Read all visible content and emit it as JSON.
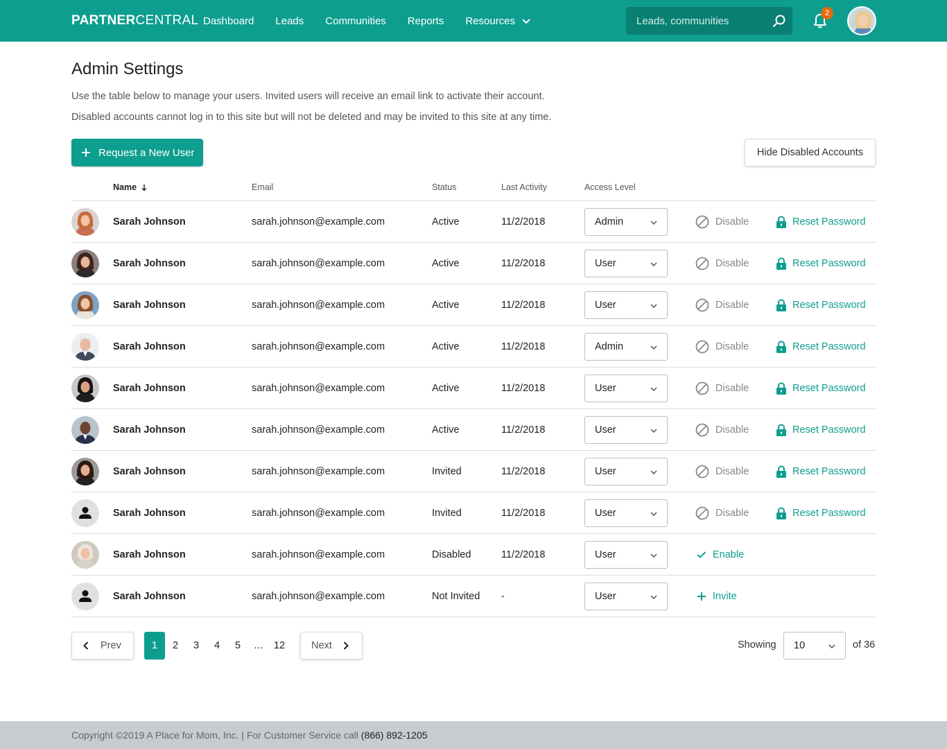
{
  "header": {
    "brand_bold": "PARTNER",
    "brand_light": "CENTRAL",
    "nav": [
      {
        "label": "Dashboard"
      },
      {
        "label": "Leads"
      },
      {
        "label": "Communities"
      },
      {
        "label": "Reports"
      },
      {
        "label": "Resources"
      }
    ],
    "search_placeholder": "Leads, communities",
    "notification_count": "2",
    "brand_color": "#0e9e8f"
  },
  "page": {
    "title": "Admin Settings",
    "description_1": "Use the table below to manage your users. Invited users will receive an email link to activate their account.",
    "description_2": "Disabled accounts cannot log in to this site but will not be deleted and may be invited to this site at any time.",
    "request_button": "Request a New User",
    "hide_disabled_button": "Hide Disabled Accounts"
  },
  "table": {
    "columns": {
      "name": "Name",
      "email": "Email",
      "status": "Status",
      "last_activity": "Last Activity",
      "access_level": "Access Level"
    },
    "rows": [
      {
        "name": "Sarah Johnson",
        "email": "sarah.johnson@example.com",
        "status": "Active",
        "last_activity": "11/2/2018",
        "access": "Admin",
        "action": "Disable",
        "secondary_action": "Reset Password",
        "avatar": "photo-1"
      },
      {
        "name": "Sarah Johnson",
        "email": "sarah.johnson@example.com",
        "status": "Active",
        "last_activity": "11/2/2018",
        "access": "User",
        "action": "Disable",
        "secondary_action": "Reset Password",
        "avatar": "photo-2"
      },
      {
        "name": "Sarah Johnson",
        "email": "sarah.johnson@example.com",
        "status": "Active",
        "last_activity": "11/2/2018",
        "access": "User",
        "action": "Disable",
        "secondary_action": "Reset Password",
        "avatar": "photo-3"
      },
      {
        "name": "Sarah Johnson",
        "email": "sarah.johnson@example.com",
        "status": "Active",
        "last_activity": "11/2/2018",
        "access": "Admin",
        "action": "Disable",
        "secondary_action": "Reset Password",
        "avatar": "photo-4"
      },
      {
        "name": "Sarah Johnson",
        "email": "sarah.johnson@example.com",
        "status": "Active",
        "last_activity": "11/2/2018",
        "access": "User",
        "action": "Disable",
        "secondary_action": "Reset Password",
        "avatar": "photo-5"
      },
      {
        "name": "Sarah Johnson",
        "email": "sarah.johnson@example.com",
        "status": "Active",
        "last_activity": "11/2/2018",
        "access": "User",
        "action": "Disable",
        "secondary_action": "Reset Password",
        "avatar": "photo-6"
      },
      {
        "name": "Sarah Johnson",
        "email": "sarah.johnson@example.com",
        "status": "Invited",
        "last_activity": "11/2/2018",
        "access": "User",
        "action": "Disable",
        "secondary_action": "Reset Password",
        "avatar": "photo-7"
      },
      {
        "name": "Sarah Johnson",
        "email": "sarah.johnson@example.com",
        "status": "Invited",
        "last_activity": "11/2/2018",
        "access": "User",
        "action": "Disable",
        "secondary_action": "Reset Password",
        "avatar": "placeholder"
      },
      {
        "name": "Sarah Johnson",
        "email": "sarah.johnson@example.com",
        "status": "Disabled",
        "last_activity": "11/2/2018",
        "access": "User",
        "action": "Enable",
        "secondary_action": "",
        "avatar": "photo-8"
      },
      {
        "name": "Sarah Johnson",
        "email": "sarah.johnson@example.com",
        "status": "Not Invited",
        "last_activity": "-",
        "access": "User",
        "action": "Invite",
        "secondary_action": "",
        "avatar": "placeholder"
      }
    ]
  },
  "pagination": {
    "prev": "Prev",
    "next": "Next",
    "pages": [
      "1",
      "2",
      "3",
      "4",
      "5",
      "…",
      "12"
    ],
    "current": "1",
    "showing_label": "Showing",
    "per_page": "10",
    "of_total": "of 36"
  },
  "footer": {
    "text": "Copyright ©2019 A Place for Mom, Inc. | For Customer Service call ",
    "phone": "(866) 892-1205"
  }
}
